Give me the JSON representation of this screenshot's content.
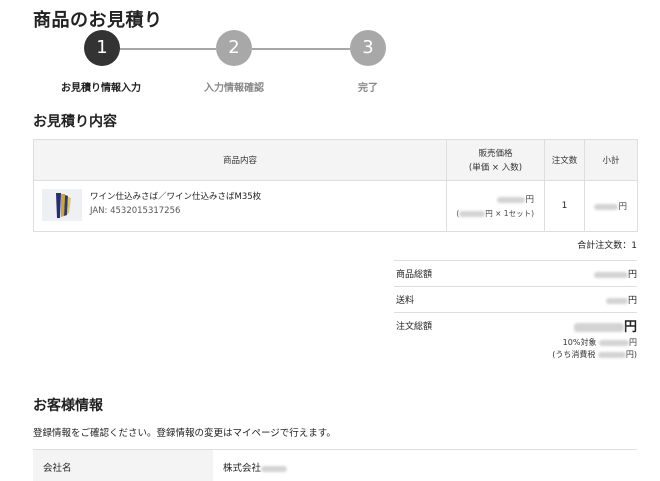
{
  "page_title": "商品のお見積り",
  "steps": [
    {
      "number": "1",
      "label": "お見積り情報入力",
      "state": "active"
    },
    {
      "number": "2",
      "label": "入力情報確認",
      "state": "inactive"
    },
    {
      "number": "3",
      "label": "完了",
      "state": "inactive"
    }
  ],
  "quote_section": {
    "title": "お見積り内容",
    "headers": {
      "item": "商品内容",
      "price_line1": "販売価格",
      "price_line2": "(単価 × 入数)",
      "qty": "注文数",
      "subtotal": "小計"
    },
    "rows": [
      {
        "name": "ワイン仕込みさば／ワイン仕込みさばM35枚",
        "jan": "JAN: 4532015317256",
        "price_suffix": "円",
        "unit_open": "(",
        "unit_suffix": "円 × 1セット)",
        "qty": "1",
        "subtotal_suffix": "円"
      }
    ],
    "total_qty": "合計注文数：1"
  },
  "summary": {
    "goods_total_label": "商品総額",
    "goods_total_suffix": "円",
    "shipping_label": "送料",
    "shipping_suffix": "円",
    "grand_total_label": "注文総額",
    "grand_total_suffix": "円",
    "tax_target_label": "10%対象",
    "tax_target_suffix": "円",
    "tax_open": "(うち消費税",
    "tax_suffix": "円)"
  },
  "customer_section": {
    "title": "お客様情報",
    "description": "登録情報をご確認ください。登録情報の変更はマイページで行えます。",
    "company_label": "会社名",
    "company_value_prefix": "株式会社"
  }
}
